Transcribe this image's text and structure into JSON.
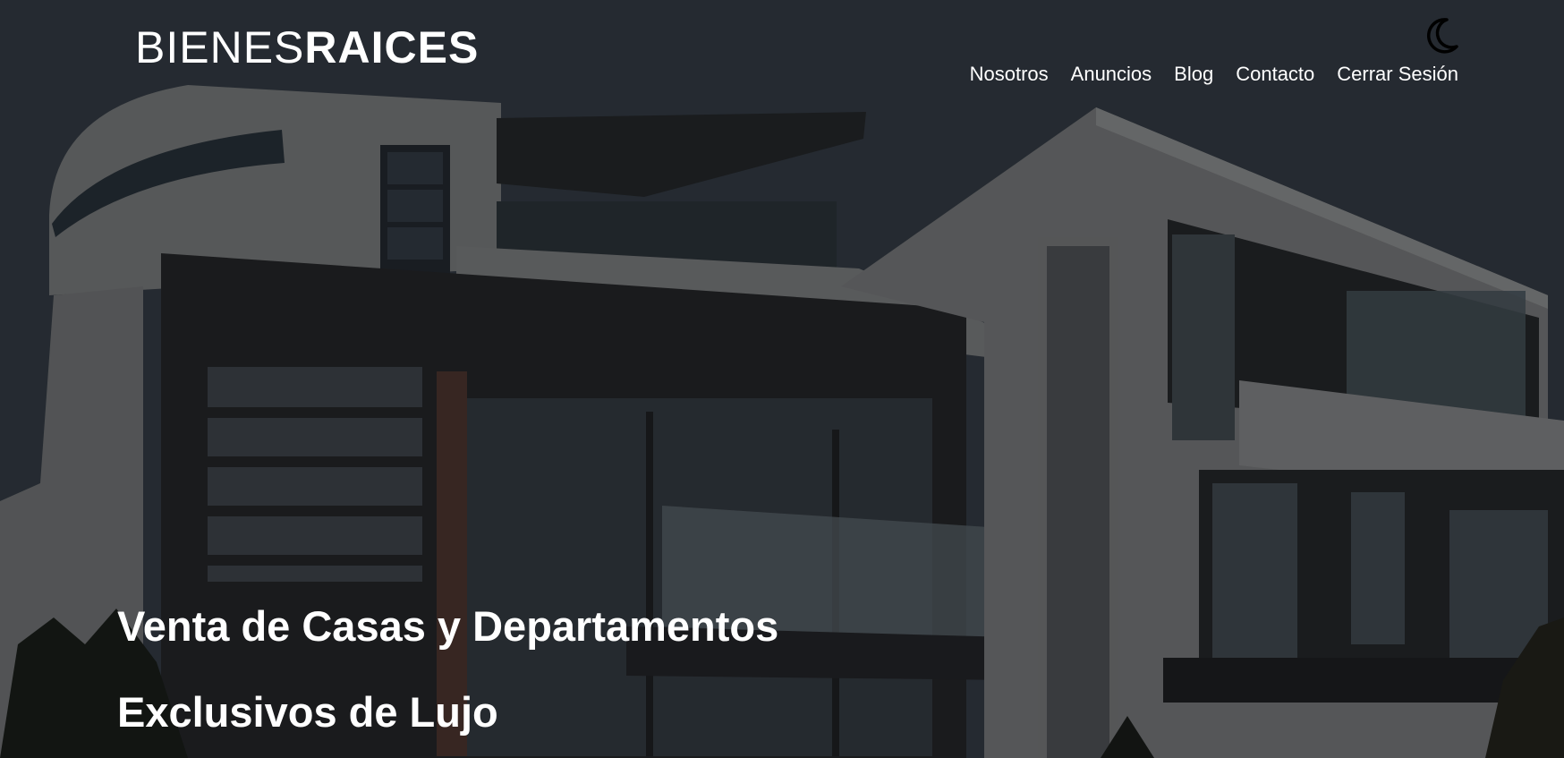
{
  "site": {
    "logo_light": "BIENES",
    "logo_bold": "RAICES"
  },
  "header": {
    "dark_mode_icon": "moon-icon",
    "nav": [
      {
        "label": "Nosotros"
      },
      {
        "label": "Anuncios"
      },
      {
        "label": "Blog"
      },
      {
        "label": "Contacto"
      },
      {
        "label": "Cerrar Sesión"
      }
    ]
  },
  "hero": {
    "title_line1": "Venta de Casas y Departamentos",
    "title_line2": "Exclusivos de Lujo",
    "image_icon": "modern-house-photo"
  }
}
